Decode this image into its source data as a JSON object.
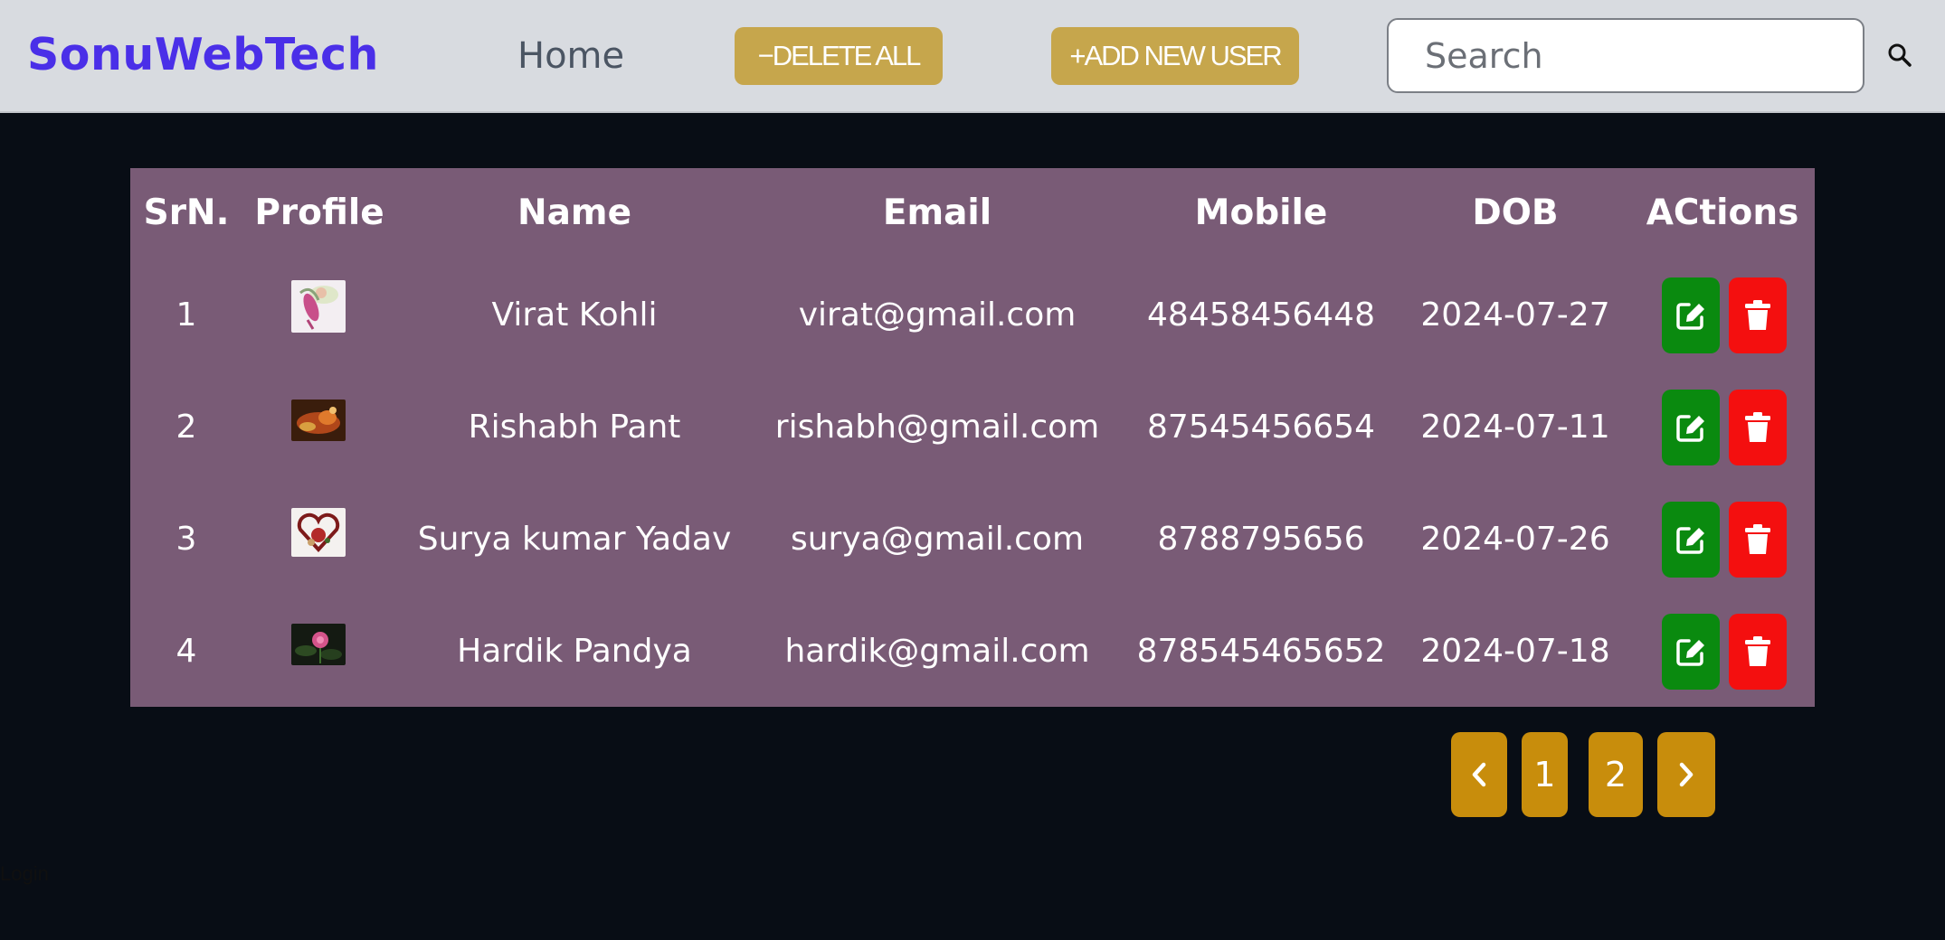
{
  "navbar": {
    "brand": "SonuWebTech",
    "home_label": "Home",
    "delete_all_label": "−DELETE ALL",
    "add_user_label": "+ADD NEW USER",
    "search_placeholder": "Search",
    "search_icon": "search-icon",
    "colors": {
      "brand": "#4a2fe8",
      "button": "#c6a64c",
      "background": "#d8dbe0"
    }
  },
  "table": {
    "headers": [
      "SrN.",
      "Profile",
      "Name",
      "Email",
      "Mobile",
      "DOB",
      "ACtions"
    ],
    "rows": [
      {
        "srno": "1",
        "name": "Virat Kohli",
        "email": "virat@gmail.com",
        "mobile": "48458456448",
        "dob": "2024-07-27"
      },
      {
        "srno": "2",
        "name": "Rishabh Pant",
        "email": "rishabh@gmail.com",
        "mobile": "87545456654",
        "dob": "2024-07-11"
      },
      {
        "srno": "3",
        "name": "Surya kumar Yadav",
        "email": "surya@gmail.com",
        "mobile": "8788795656",
        "dob": "2024-07-26"
      },
      {
        "srno": "4",
        "name": "Hardik Pandya",
        "email": "hardik@gmail.com",
        "mobile": "878545465652",
        "dob": "2024-07-18"
      }
    ],
    "action_icons": [
      "edit-icon",
      "trash-icon"
    ],
    "colors": {
      "panel": "#795b76",
      "edit": "#0a8a0f",
      "delete": "#f40f0f"
    }
  },
  "pagination": {
    "prev_icon": "chevron-left-icon",
    "pages": [
      "1",
      "2"
    ],
    "next_icon": "chevron-right-icon",
    "color": "#c88d0c"
  },
  "footer": {
    "login_label": "Login"
  }
}
